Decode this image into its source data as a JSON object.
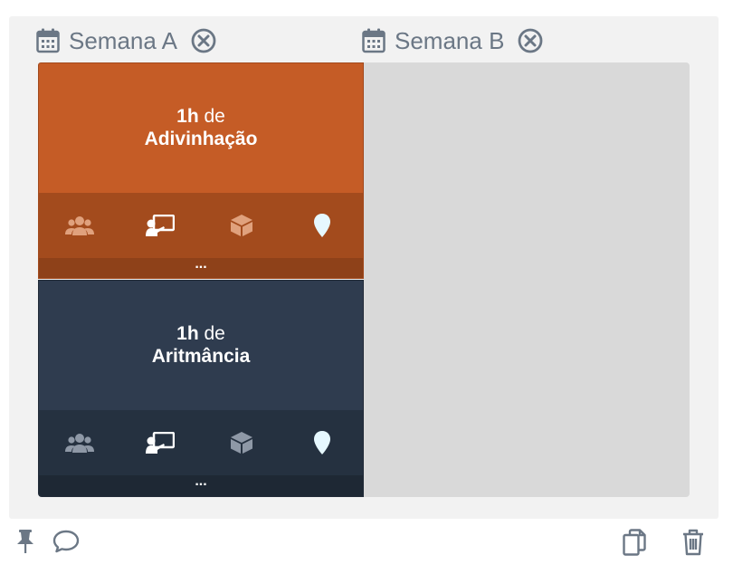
{
  "weeks": [
    {
      "label": "Semana A"
    },
    {
      "label": "Semana B"
    }
  ],
  "lessons": [
    {
      "hours": "1h",
      "connector": "de",
      "subject": "Adivinhação",
      "more": "...",
      "color": "#c55c26"
    },
    {
      "hours": "1h",
      "connector": "de",
      "subject": "Aritmância",
      "more": "...",
      "color": "#2f3c4f"
    }
  ],
  "icons": {
    "week": "calendar-icon",
    "remove": "close-circle-icon",
    "lesson_row": [
      "group-icon",
      "teacher-icon",
      "box-icon",
      "location-icon"
    ],
    "footer_left": [
      "pin-icon",
      "comment-icon"
    ],
    "footer_right": [
      "copy-icon",
      "trash-icon"
    ]
  }
}
